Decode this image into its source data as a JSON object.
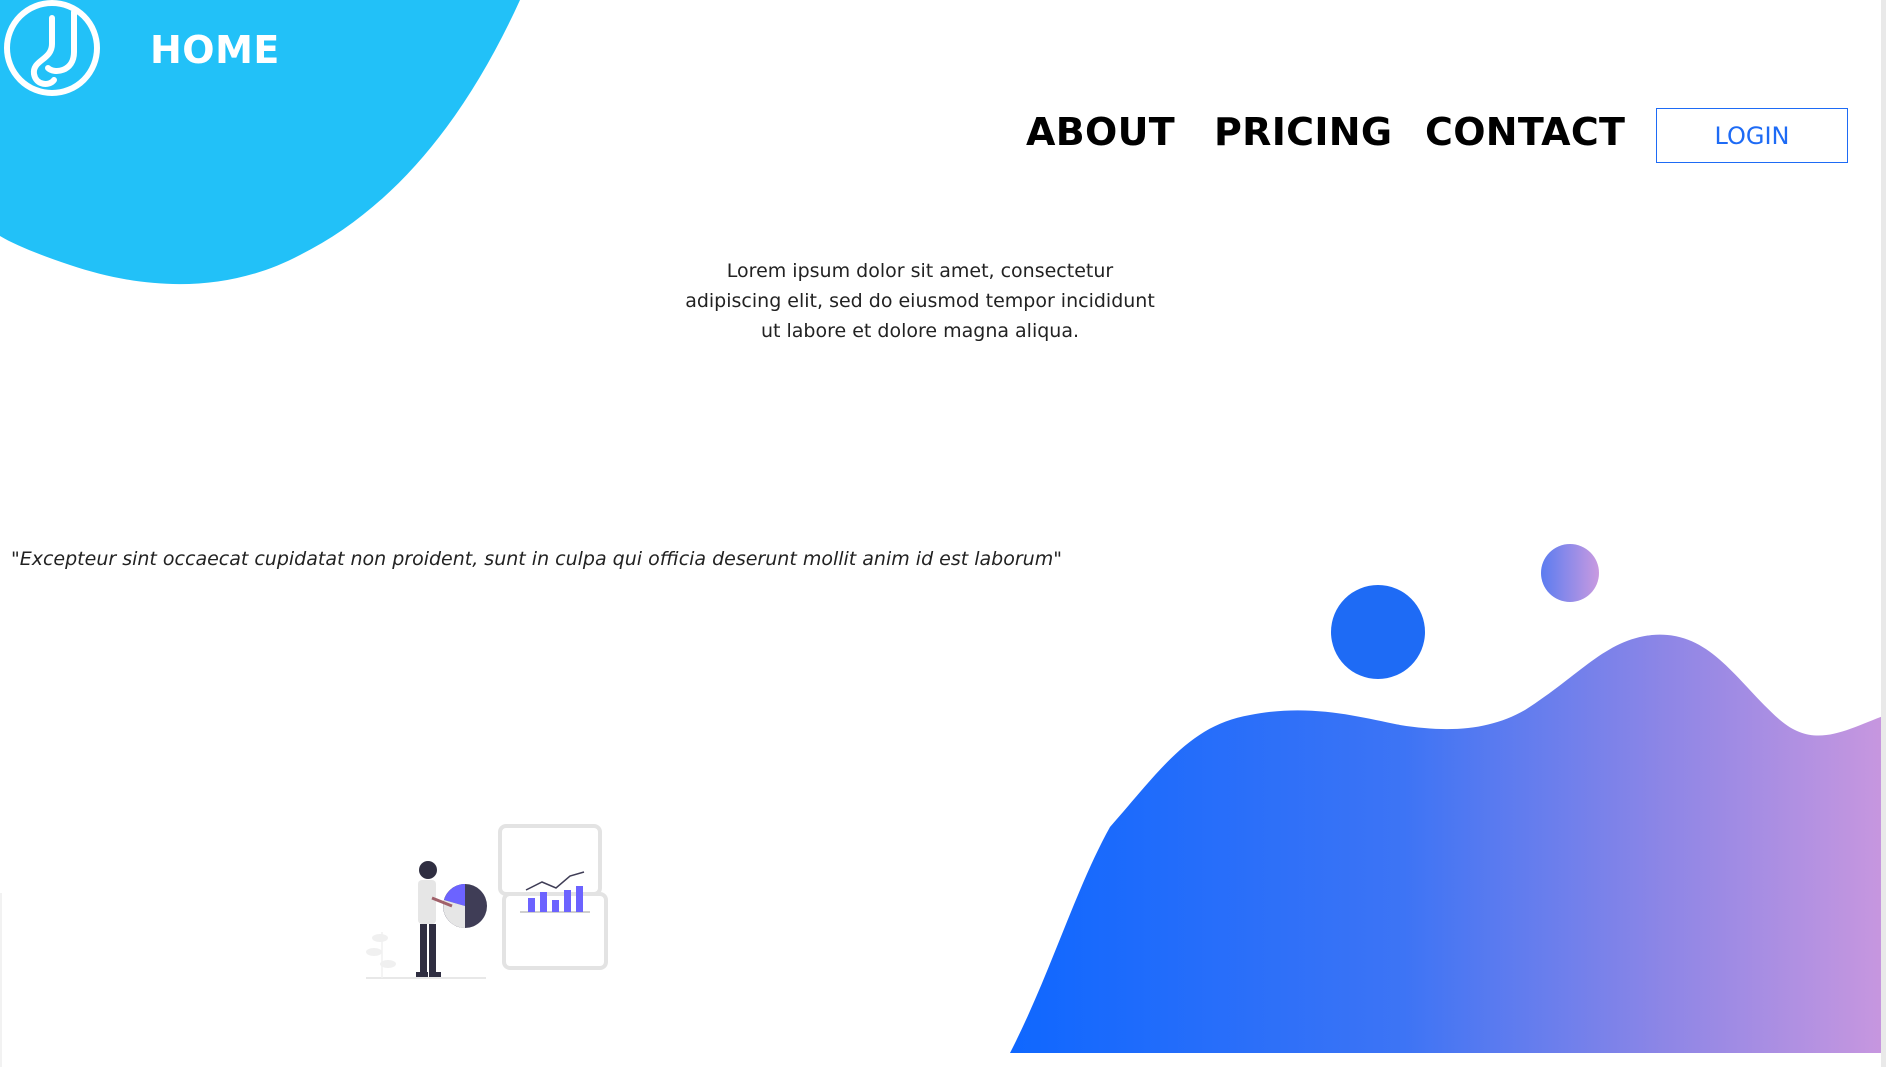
{
  "nav": {
    "home_label": "HOME",
    "about_label": "ABOUT",
    "pricing_label": "PRICING",
    "contact_label": "CONTACT",
    "login_label": "LOGIN"
  },
  "hero": {
    "intro_text": "Lorem ipsum dolor sit amet, consectetur adipiscing elit, sed do eiusmod tempor incididunt ut labore et dolore magna aliqua.",
    "quote_text": "\"Excepteur sint occaecat cupidatat non proident, sunt in culpa qui officia deserunt mollit anim id est laborum\""
  },
  "icons": {
    "logo": "music-note-logo-icon",
    "illustration": "person-with-charts-illustration"
  },
  "colors": {
    "top_blob": "#22c1f8",
    "accent_blue": "#1e6bf5",
    "gradient_start": "#0f67ff",
    "gradient_end": "#c897df",
    "nav_text": "#000000",
    "illustration_purple": "#6c63ff"
  }
}
